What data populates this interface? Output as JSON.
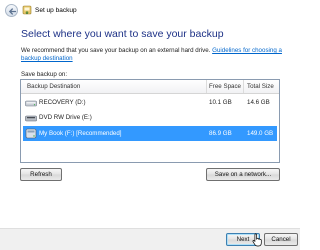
{
  "window": {
    "title": "Set up backup",
    "back_icon": "back-arrow-icon",
    "app_icon": "backup-icon"
  },
  "heading": "Select where you want to save your backup",
  "description": {
    "text": "We recommend that you save your backup on an external hard drive. ",
    "link": "Guidelines for choosing a backup destination"
  },
  "save_label": "Save backup on:",
  "table": {
    "columns": [
      "Backup Destination",
      "Free Space",
      "Total Size"
    ],
    "rows": [
      {
        "name": "RECOVERY (D:)",
        "free": "10.1 GB",
        "total": "14.6 GB",
        "icon": "hard-drive-icon",
        "selected": false
      },
      {
        "name": "DVD RW Drive (E:)",
        "free": "",
        "total": "",
        "icon": "dvd-drive-icon",
        "selected": false
      },
      {
        "name": "My Book (F:) [Recommended]",
        "free": "86.9 GB",
        "total": "149.0 GB",
        "icon": "external-drive-icon",
        "selected": true
      }
    ]
  },
  "buttons": {
    "refresh": "Refresh",
    "save_network": "Save on a network...",
    "next": "Next",
    "cancel": "Cancel"
  },
  "colors": {
    "heading": "#1e3287",
    "link": "#0066cc",
    "selection": "#3399ff"
  }
}
